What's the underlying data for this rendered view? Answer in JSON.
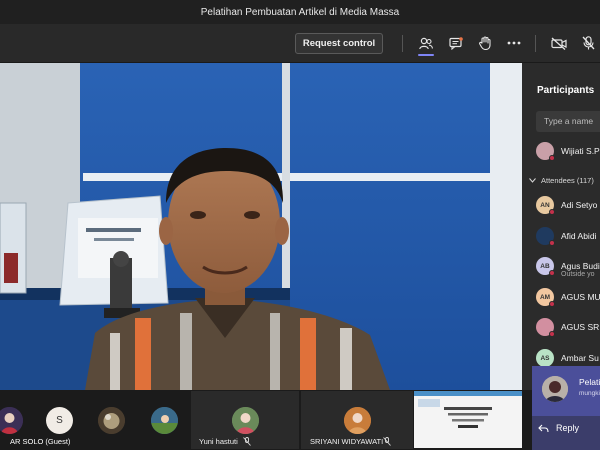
{
  "window": {
    "title": "Pelatihan Pembuatan Artikel di Media Massa"
  },
  "toolbar": {
    "request_control": "Request control",
    "icons": [
      "participants-icon",
      "chat-icon",
      "raise-hand-icon",
      "more-options-icon",
      "camera-off-icon",
      "mic-off-icon"
    ]
  },
  "participants": {
    "title": "Participants",
    "search_placeholder": "Type a name",
    "presenter": {
      "name": "Wijiati S.P",
      "avatar_color": "#c9a0a8"
    },
    "attendees_label": "Attendees (117)",
    "attendees": [
      {
        "initials": "AN",
        "name": "Adi Setyo",
        "avatar_color": "#e8c9a0",
        "subtitle": ""
      },
      {
        "initials": "",
        "name": "Afid Abidi",
        "avatar_color": "#1f3a5f",
        "subtitle": ""
      },
      {
        "initials": "AB",
        "name": "Agus Budi",
        "avatar_color": "#c9c7ea",
        "subtitle": "Outside yo"
      },
      {
        "initials": "AM",
        "name": "AGUS MU",
        "avatar_color": "#f2c7a0",
        "subtitle": ""
      },
      {
        "initials": "",
        "name": "AGUS SRI",
        "avatar_color": "#d28fa0",
        "subtitle": ""
      },
      {
        "initials": "AS",
        "name": "Ambar Su",
        "avatar_color": "#b9e3c6",
        "subtitle": ""
      }
    ]
  },
  "notification": {
    "title": "Pelati",
    "subtitle": "mungki",
    "reply_label": "Reply"
  },
  "strip": {
    "thumbs": [
      {
        "initials": "",
        "color": "#3b2f56"
      },
      {
        "initials": "S",
        "color": "#f1ece6"
      },
      {
        "initials": "",
        "color": "#4a3d2e"
      },
      {
        "initials": "",
        "color": "#3a6a8a"
      }
    ],
    "tiles": [
      {
        "name": "Yuni hastuti",
        "avatar_color": "#6a8a5a"
      },
      {
        "name": "SRIYANI WIDYAWATI",
        "avatar_color": "#c87c3a"
      }
    ],
    "share_label": "AR SOLO (Guest)"
  },
  "colors": {
    "accent": "#7f85f5",
    "alert": "#c4314b",
    "panel_bg": "#2b2b2b",
    "bar_bg": "#292929"
  }
}
